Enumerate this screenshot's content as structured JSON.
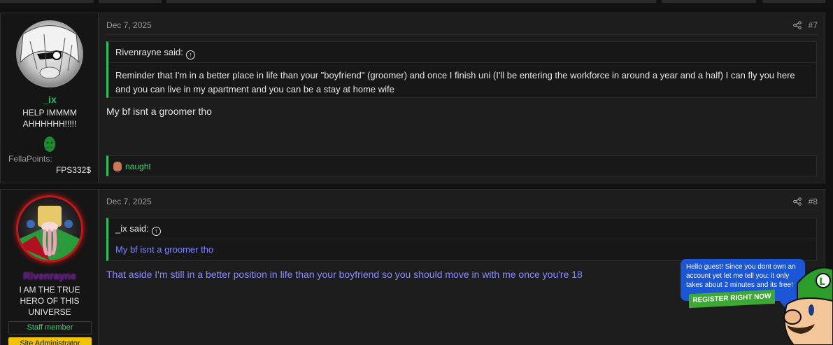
{
  "posts": [
    {
      "author": "_ix",
      "author_color": "#22c55e",
      "user_title": "HELP IMMMM AHHHHHH!!!!!",
      "fella_label": "FellaPoints:",
      "fella_value": "FPS332$",
      "date": "Dec 7, 2025",
      "number": "#7",
      "quote": {
        "author": "Rivenrayne said:",
        "text": "Reminder that I'm in a better place in life than your \"boyfriend\" (groomer) and once I finish uni (I'll be entering the workforce in around a year and a half) I can fly you here and you can live in my apartment and you can be a stay at home wife"
      },
      "message": "My bf isnt a groomer tho",
      "reaction_user": "naught"
    },
    {
      "author": "Rivenrayne",
      "author_color": "#6a1e8c",
      "user_title": "I AM THE TRUE HERO OF THIS UNIVERSE",
      "badges": [
        "Staff member",
        "Site Administrator"
      ],
      "date": "Dec 7, 2025",
      "number": "#8",
      "quote": {
        "author": "_ix said:",
        "text": "My bf isnt a groomer tho",
        "text_color": "#7e86ff"
      },
      "message": "That aside I'm still in a better position in life than your boyfriend so you should move in with me once you're 18",
      "message_color": "#8a8cff"
    }
  ],
  "guest_popup": {
    "text": "Hello guest! Since you dont own an account yet let me tell you: it only takes about 2 minutes and its free!",
    "button": "REGISTER RIGHT NOW"
  },
  "colors": {
    "accent_green": "#22c55e",
    "popup_blue": "#1a56d6",
    "admin_yellow": "#f2c400"
  }
}
